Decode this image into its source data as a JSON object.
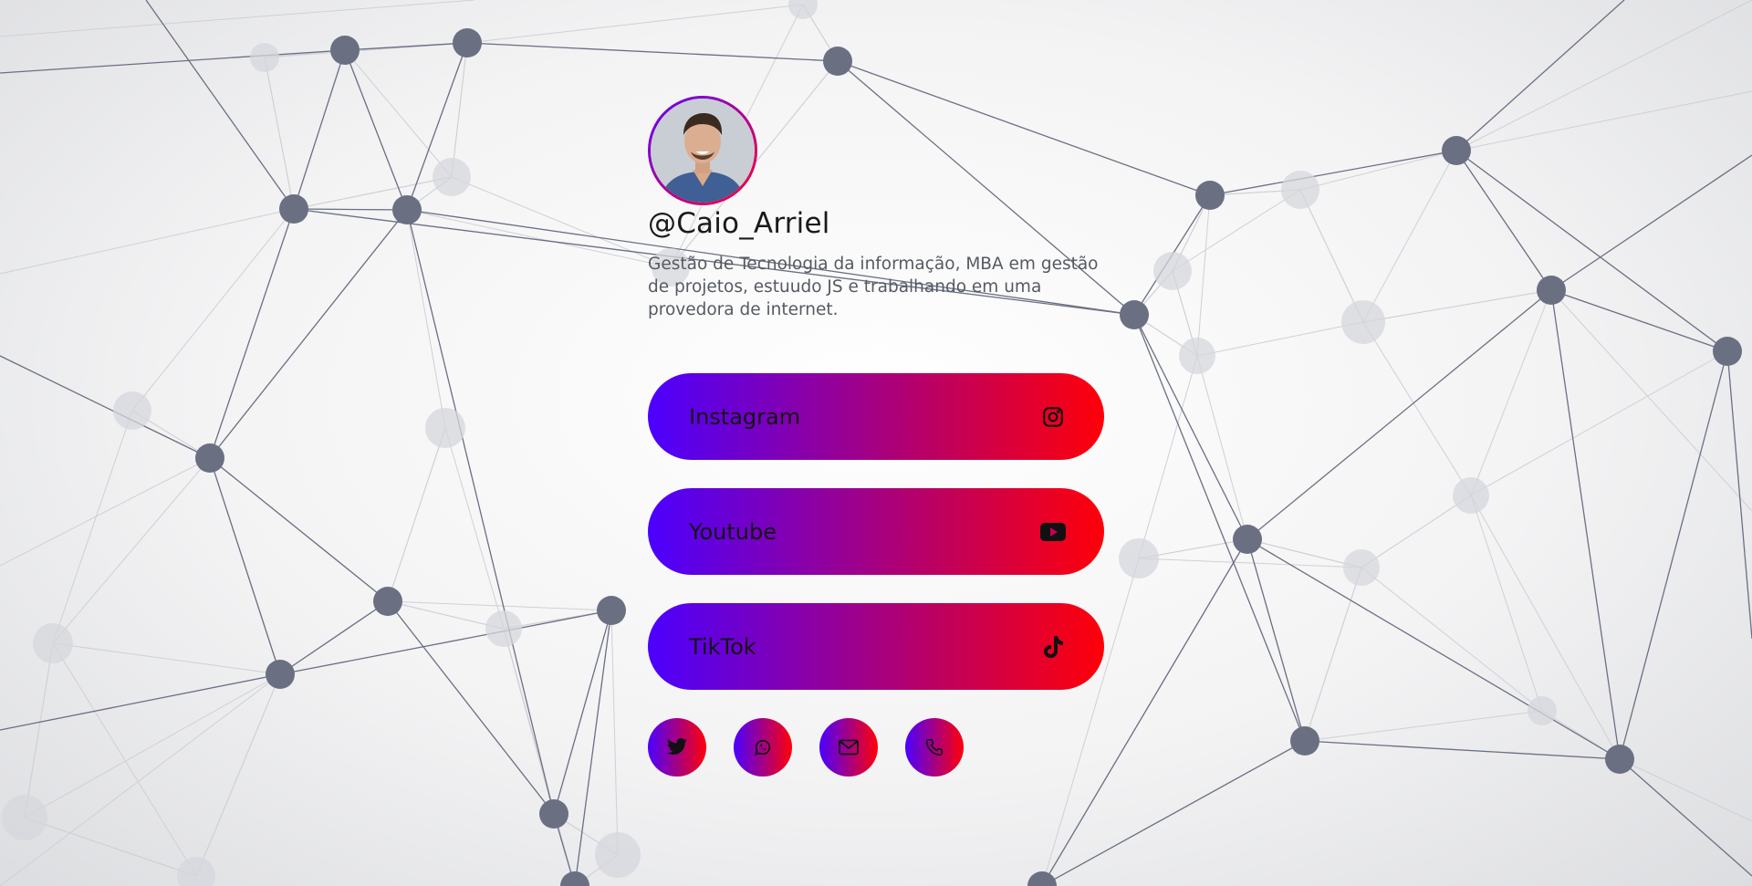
{
  "profile": {
    "handle": "@Caio_Arriel",
    "bio": "Gestão de Tecnologia da informação, MBA em gestão de projetos, estuudo JS e trabalhando em uma provedora de internet."
  },
  "links": [
    {
      "label": "Instagram",
      "icon": "instagram-icon"
    },
    {
      "label": "Youtube",
      "icon": "youtube-icon"
    },
    {
      "label": "TikTok",
      "icon": "tiktok-icon"
    }
  ],
  "socials": [
    {
      "icon": "twitter-icon"
    },
    {
      "icon": "whatsapp-icon"
    },
    {
      "icon": "mail-icon"
    },
    {
      "icon": "phone-icon"
    }
  ],
  "colors": {
    "gradient_start": "#4b00ff",
    "gradient_end": "#ff0008",
    "node": "#6b6f82",
    "node_faint": "#d6d7dc"
  }
}
